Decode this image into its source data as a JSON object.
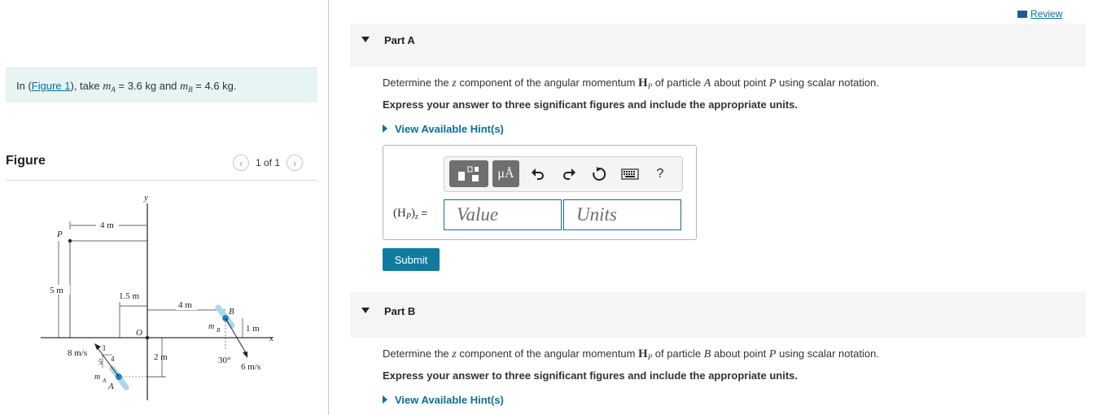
{
  "problem": {
    "prefix": "In (",
    "figure_link": "Figure 1",
    "middle": "), take ",
    "mA_symbol": "m",
    "mA_sub": "A",
    "mA_value": " = 3.6 kg",
    "and": " and ",
    "mB_symbol": "m",
    "mB_sub": "B",
    "mB_value": " = 4.6 kg."
  },
  "figure_panel": {
    "title": "Figure",
    "pager": "1 of 1",
    "labels": {
      "y": "y",
      "x": "x",
      "P": "P",
      "O": "O",
      "B": "B",
      "d4m_top": "4 m",
      "d5m": "5 m",
      "d15m": "1.5 m",
      "d4m_mid": "4 m",
      "d1m": "1 m",
      "d2m": "2 m",
      "vA": "8 m/s",
      "vB": "6 m/s",
      "angle": "30°",
      "mB_label": "m",
      "mB_sub": "B",
      "mA_label": "m",
      "mA_sub": "A",
      "A": "A",
      "tri_3": "3",
      "tri_4": "4",
      "tri_5": "5"
    }
  },
  "review": "Review",
  "partA": {
    "title": "Part A",
    "q_pre": "Determine the ",
    "q_z": "z",
    "q_mid": " component of the angular momentum ",
    "q_H": "H",
    "q_Hsub": "P",
    "q_mid2": " of particle ",
    "q_particle": "A",
    "q_mid3": " about point ",
    "q_point": "P",
    "q_post": " using scalar notation.",
    "instruction": "Express your answer to three significant figures and include the appropriate units.",
    "hint": "View Available Hint(s)",
    "eq_label": "(H",
    "eq_sub": "P",
    "eq_close": ")",
    "eq_zsub": "z",
    "eq_eq": " =",
    "value_placeholder": "Value",
    "units_placeholder": "Units",
    "submit": "Submit",
    "toolbar": {
      "templates": "templates-icon",
      "symbols": "μÅ",
      "undo": "undo-icon",
      "redo": "redo-icon",
      "reset": "reset-icon",
      "keyboard": "keyboard-icon",
      "help": "?"
    }
  },
  "partB": {
    "title": "Part B",
    "q_pre": "Determine the ",
    "q_z": "z",
    "q_mid": " component of the angular momentum ",
    "q_H": "H",
    "q_Hsub": "P",
    "q_mid2": " of particle ",
    "q_particle": "B",
    "q_mid3": " about point ",
    "q_point": "P",
    "q_post": " using scalar notation.",
    "instruction": "Express your answer to three significant figures and include the appropriate units.",
    "hint": "View Available Hint(s)"
  }
}
